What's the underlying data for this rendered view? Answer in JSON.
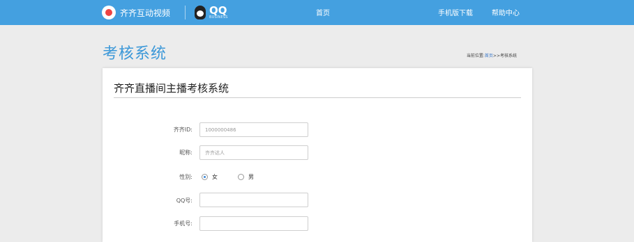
{
  "header": {
    "brand_name": "齐齐互动视频",
    "qq_logo_text": "QQ",
    "qq_logo_subtext": "BUSINESS",
    "nav": {
      "home": "首页",
      "mobile": "手机版下载",
      "help": "帮助中心"
    },
    "accent_color": "#44a0e0"
  },
  "page": {
    "title": "考核系统",
    "breadcrumb": {
      "prefix": "当前位置:",
      "home_link": "首页",
      "separator": ">>",
      "current": "考核系统"
    }
  },
  "form": {
    "title": "齐齐直播间主播考核系统",
    "fields": {
      "qiqi_id": {
        "label": "齐齐ID:",
        "value": "1000000486",
        "placeholder": ""
      },
      "nickname": {
        "label": "昵称:",
        "value": "齐齐达人",
        "placeholder": ""
      },
      "gender": {
        "label": "性别:",
        "options": [
          {
            "label": "女",
            "checked": true
          },
          {
            "label": "男",
            "checked": false
          }
        ]
      },
      "qq": {
        "label": "QQ号:",
        "value": "",
        "placeholder": ""
      },
      "phone": {
        "label": "手机号:",
        "value": "",
        "placeholder": ""
      }
    }
  }
}
